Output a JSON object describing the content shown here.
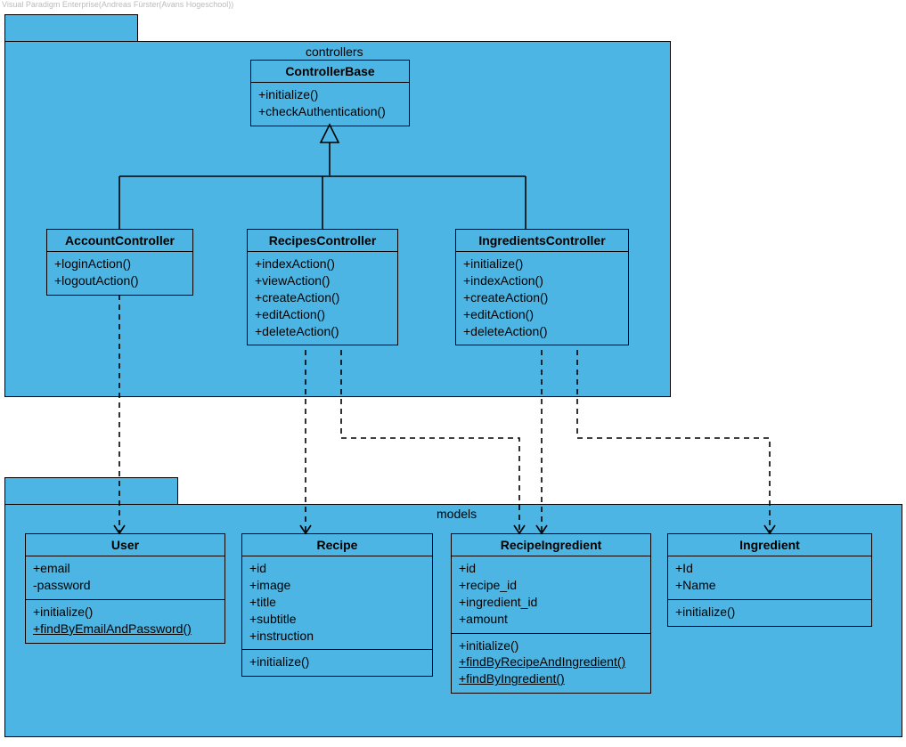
{
  "watermark": "Visual Paradigm Enterprise(Andreas Fürster(Avans Hogeschool))",
  "packages": {
    "controllers": {
      "label": "controllers"
    },
    "models": {
      "label": "models"
    }
  },
  "classes": {
    "ControllerBase": {
      "title": "ControllerBase",
      "ops": [
        "+initialize()",
        "+checkAuthentication()"
      ]
    },
    "AccountController": {
      "title": "AccountController",
      "ops": [
        "+loginAction()",
        "+logoutAction()"
      ]
    },
    "RecipesController": {
      "title": "RecipesController",
      "ops": [
        "+indexAction()",
        "+viewAction()",
        "+createAction()",
        "+editAction()",
        "+deleteAction()"
      ]
    },
    "IngredientsController": {
      "title": "IngredientsController",
      "ops": [
        "+initialize()",
        "+indexAction()",
        "+createAction()",
        "+editAction()",
        "+deleteAction()"
      ]
    },
    "User": {
      "title": "User",
      "attrs": [
        "+email",
        "-password"
      ],
      "ops": [
        {
          "t": "+initialize()",
          "u": false
        },
        {
          "t": "+findByEmailAndPassword()",
          "u": true
        }
      ]
    },
    "Recipe": {
      "title": "Recipe",
      "attrs": [
        "+id",
        "+image",
        "+title",
        "+subtitle",
        "+instruction"
      ],
      "ops": [
        {
          "t": "+initialize()",
          "u": false
        }
      ]
    },
    "RecipeIngredient": {
      "title": "RecipeIngredient",
      "attrs": [
        "+id",
        "+recipe_id",
        "+ingredient_id",
        "+amount"
      ],
      "ops": [
        {
          "t": "+initialize()",
          "u": false
        },
        {
          "t": "+findByRecipeAndIngredient()",
          "u": true
        },
        {
          "t": "+findByIngredient()",
          "u": true
        }
      ]
    },
    "Ingredient": {
      "title": "Ingredient",
      "attrs": [
        "+Id",
        "+Name"
      ],
      "ops": [
        {
          "t": "+initialize()",
          "u": false
        }
      ]
    }
  }
}
